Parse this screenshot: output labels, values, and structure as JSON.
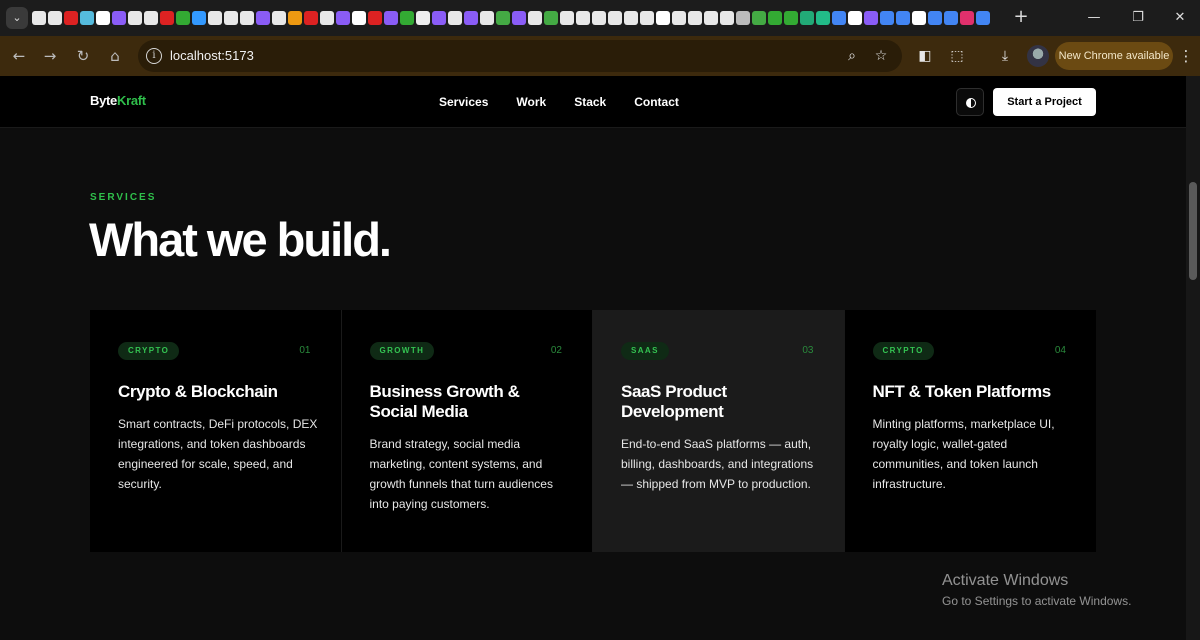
{
  "browser": {
    "tab_favicons": [
      "github",
      "github",
      "opera",
      "react",
      "vercel",
      "bolt",
      "github",
      "github",
      "opera",
      "green-app",
      "list",
      "github",
      "github",
      "github",
      "bolt",
      "github",
      "slack",
      "opera",
      "github",
      "bolt",
      "vercel",
      "opera",
      "bolt",
      "green-app",
      "layers",
      "bolt",
      "github",
      "bolt",
      "github",
      "chart",
      "bolt",
      "github",
      "chart",
      "github",
      "github",
      "github",
      "github",
      "github",
      "github",
      "vercel",
      "github",
      "github",
      "github",
      "github",
      "stripes",
      "chart",
      "green-app",
      "green-app",
      "calendar",
      "plus",
      "google",
      "vercel",
      "bolt",
      "google",
      "google",
      "vercel",
      "google",
      "google",
      "instagram",
      "google",
      "google",
      "bolt"
    ],
    "colors": {
      "chrome_frame": "#1c1c1c",
      "toolbar": "#3d2a0d"
    },
    "url": "localhost:5173",
    "update_pill": "New Chrome available"
  },
  "site": {
    "logo_part1": "Byte",
    "logo_part2": "Kraft",
    "nav": [
      "Services",
      "Work",
      "Stack",
      "Contact"
    ],
    "cta": "Start a Project",
    "accent_color": "#2fbf4b"
  },
  "services": {
    "eyebrow": "SERVICES",
    "heading": "What we build.",
    "cards": [
      {
        "tag": "CRYPTO",
        "num": "01",
        "title": "Crypto & Blockchain",
        "desc": "Smart contracts, DeFi protocols, DEX integrations, and token dashboards engineered for scale, speed, and security."
      },
      {
        "tag": "GROWTH",
        "num": "02",
        "title": "Business Growth & Social Media",
        "desc": "Brand strategy, social media marketing, content systems, and growth funnels that turn audiences into paying customers."
      },
      {
        "tag": "SAAS",
        "num": "03",
        "title": "SaaS Product Development",
        "desc": "End-to-end SaaS platforms — auth, billing, dashboards, and integrations — shipped from MVP to production."
      },
      {
        "tag": "CRYPTO",
        "num": "04",
        "title": "NFT & Token Platforms",
        "desc": "Minting platforms, marketplace UI, royalty logic, wallet-gated communities, and token launch infrastructure."
      }
    ]
  },
  "os_overlay": {
    "line1": "Activate Windows",
    "line2": "Go to Settings to activate Windows."
  }
}
